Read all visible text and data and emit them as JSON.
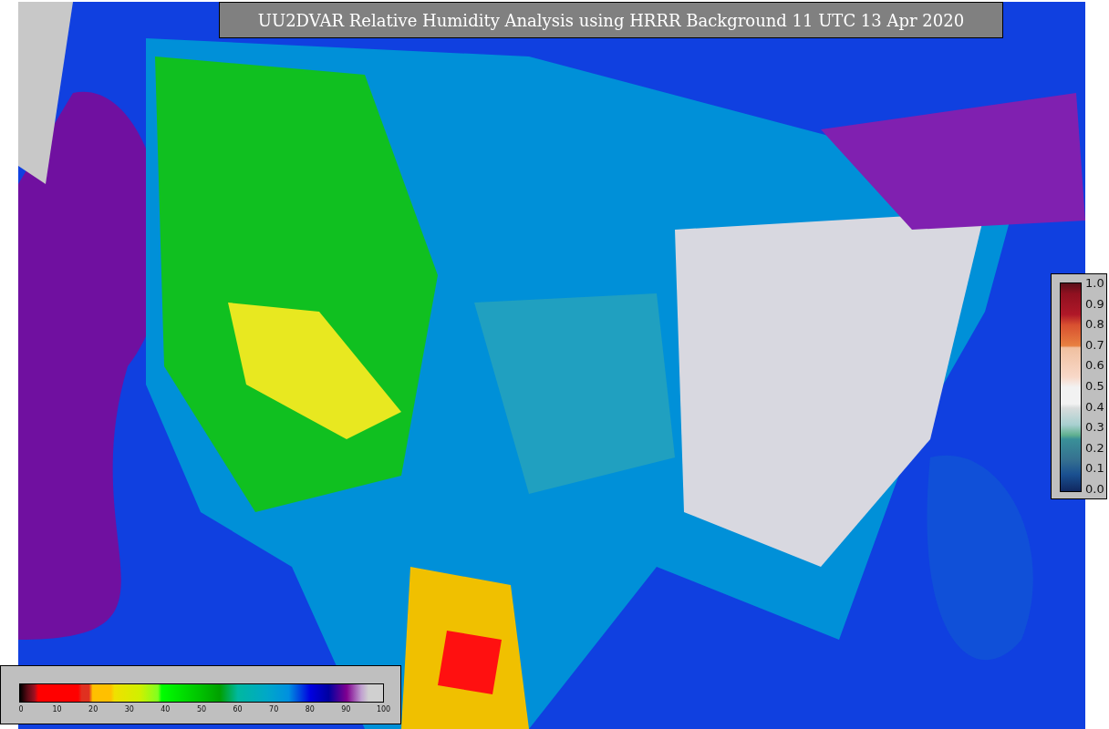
{
  "title": "UU2DVAR Relative Humidity Analysis using HRRR Background 11 UTC 13 Apr 2020",
  "observation_legend": {
    "ticks": [
      "1.0",
      "0.9",
      "0.8",
      "0.7",
      "0.6",
      "0.5",
      "0.4",
      "0.3",
      "0.2",
      "0.1",
      "0.0"
    ]
  },
  "humidity_legend": {
    "ticks": [
      "0",
      "10",
      "20",
      "30",
      "40",
      "50",
      "60",
      "70",
      "80",
      "90",
      "100"
    ]
  }
}
